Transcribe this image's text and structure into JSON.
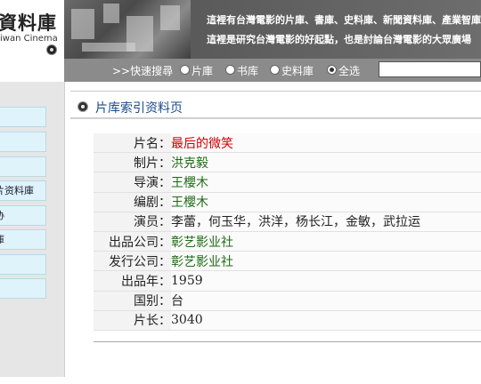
{
  "header": {
    "logo_cn": "資料庫",
    "logo_en": "iwan Cinema",
    "tagline_1": "這裡有台灣電影的片庫、書庫、史料庫、新聞資料庫、產業智庫、",
    "tagline_2": "這裡是研究台灣電影的好起點，也是討論台灣電影的大眾廣場"
  },
  "search": {
    "label": ">>快速搜尋",
    "options": [
      {
        "label": "片庫",
        "selected": false
      },
      {
        "label": "书库",
        "selected": false
      },
      {
        "label": "史料庫",
        "selected": false
      },
      {
        "label": "全选",
        "selected": true
      }
    ],
    "input_value": ""
  },
  "nav": {
    "items": [
      "",
      "",
      "",
      "片资料庫",
      "协",
      "庫",
      "",
      ""
    ]
  },
  "main": {
    "title": "片库索引资料页",
    "rows": [
      {
        "label": "片名：",
        "value": "最后的微笑",
        "style": "red"
      },
      {
        "label": "制片：",
        "value": "洪克毅",
        "style": "green"
      },
      {
        "label": "导演：",
        "value": "王櫻木",
        "style": "green"
      },
      {
        "label": "编剧：",
        "value": "王櫻木",
        "style": "green"
      },
      {
        "label": "演员：",
        "value": "李蕾，何玉华，洪洋，杨长江，金敏，武拉运",
        "style": "black"
      },
      {
        "label": "出品公司：",
        "value": "彰艺影业社",
        "style": "green"
      },
      {
        "label": "发行公司：",
        "value": "彰艺影业社",
        "style": "green"
      },
      {
        "label": "出品年：",
        "value": "1959",
        "style": "black"
      },
      {
        "label": "国别：",
        "value": "台",
        "style": "black"
      },
      {
        "label": "片长：",
        "value": "3040",
        "style": "black"
      }
    ]
  },
  "colors": {
    "title_blue": "#1a4d8a",
    "value_red": "#cc0000",
    "value_green": "#1e6b14",
    "nav_item_bg": "#dff3fb",
    "searchbar_bg": "#8b8b8b"
  }
}
